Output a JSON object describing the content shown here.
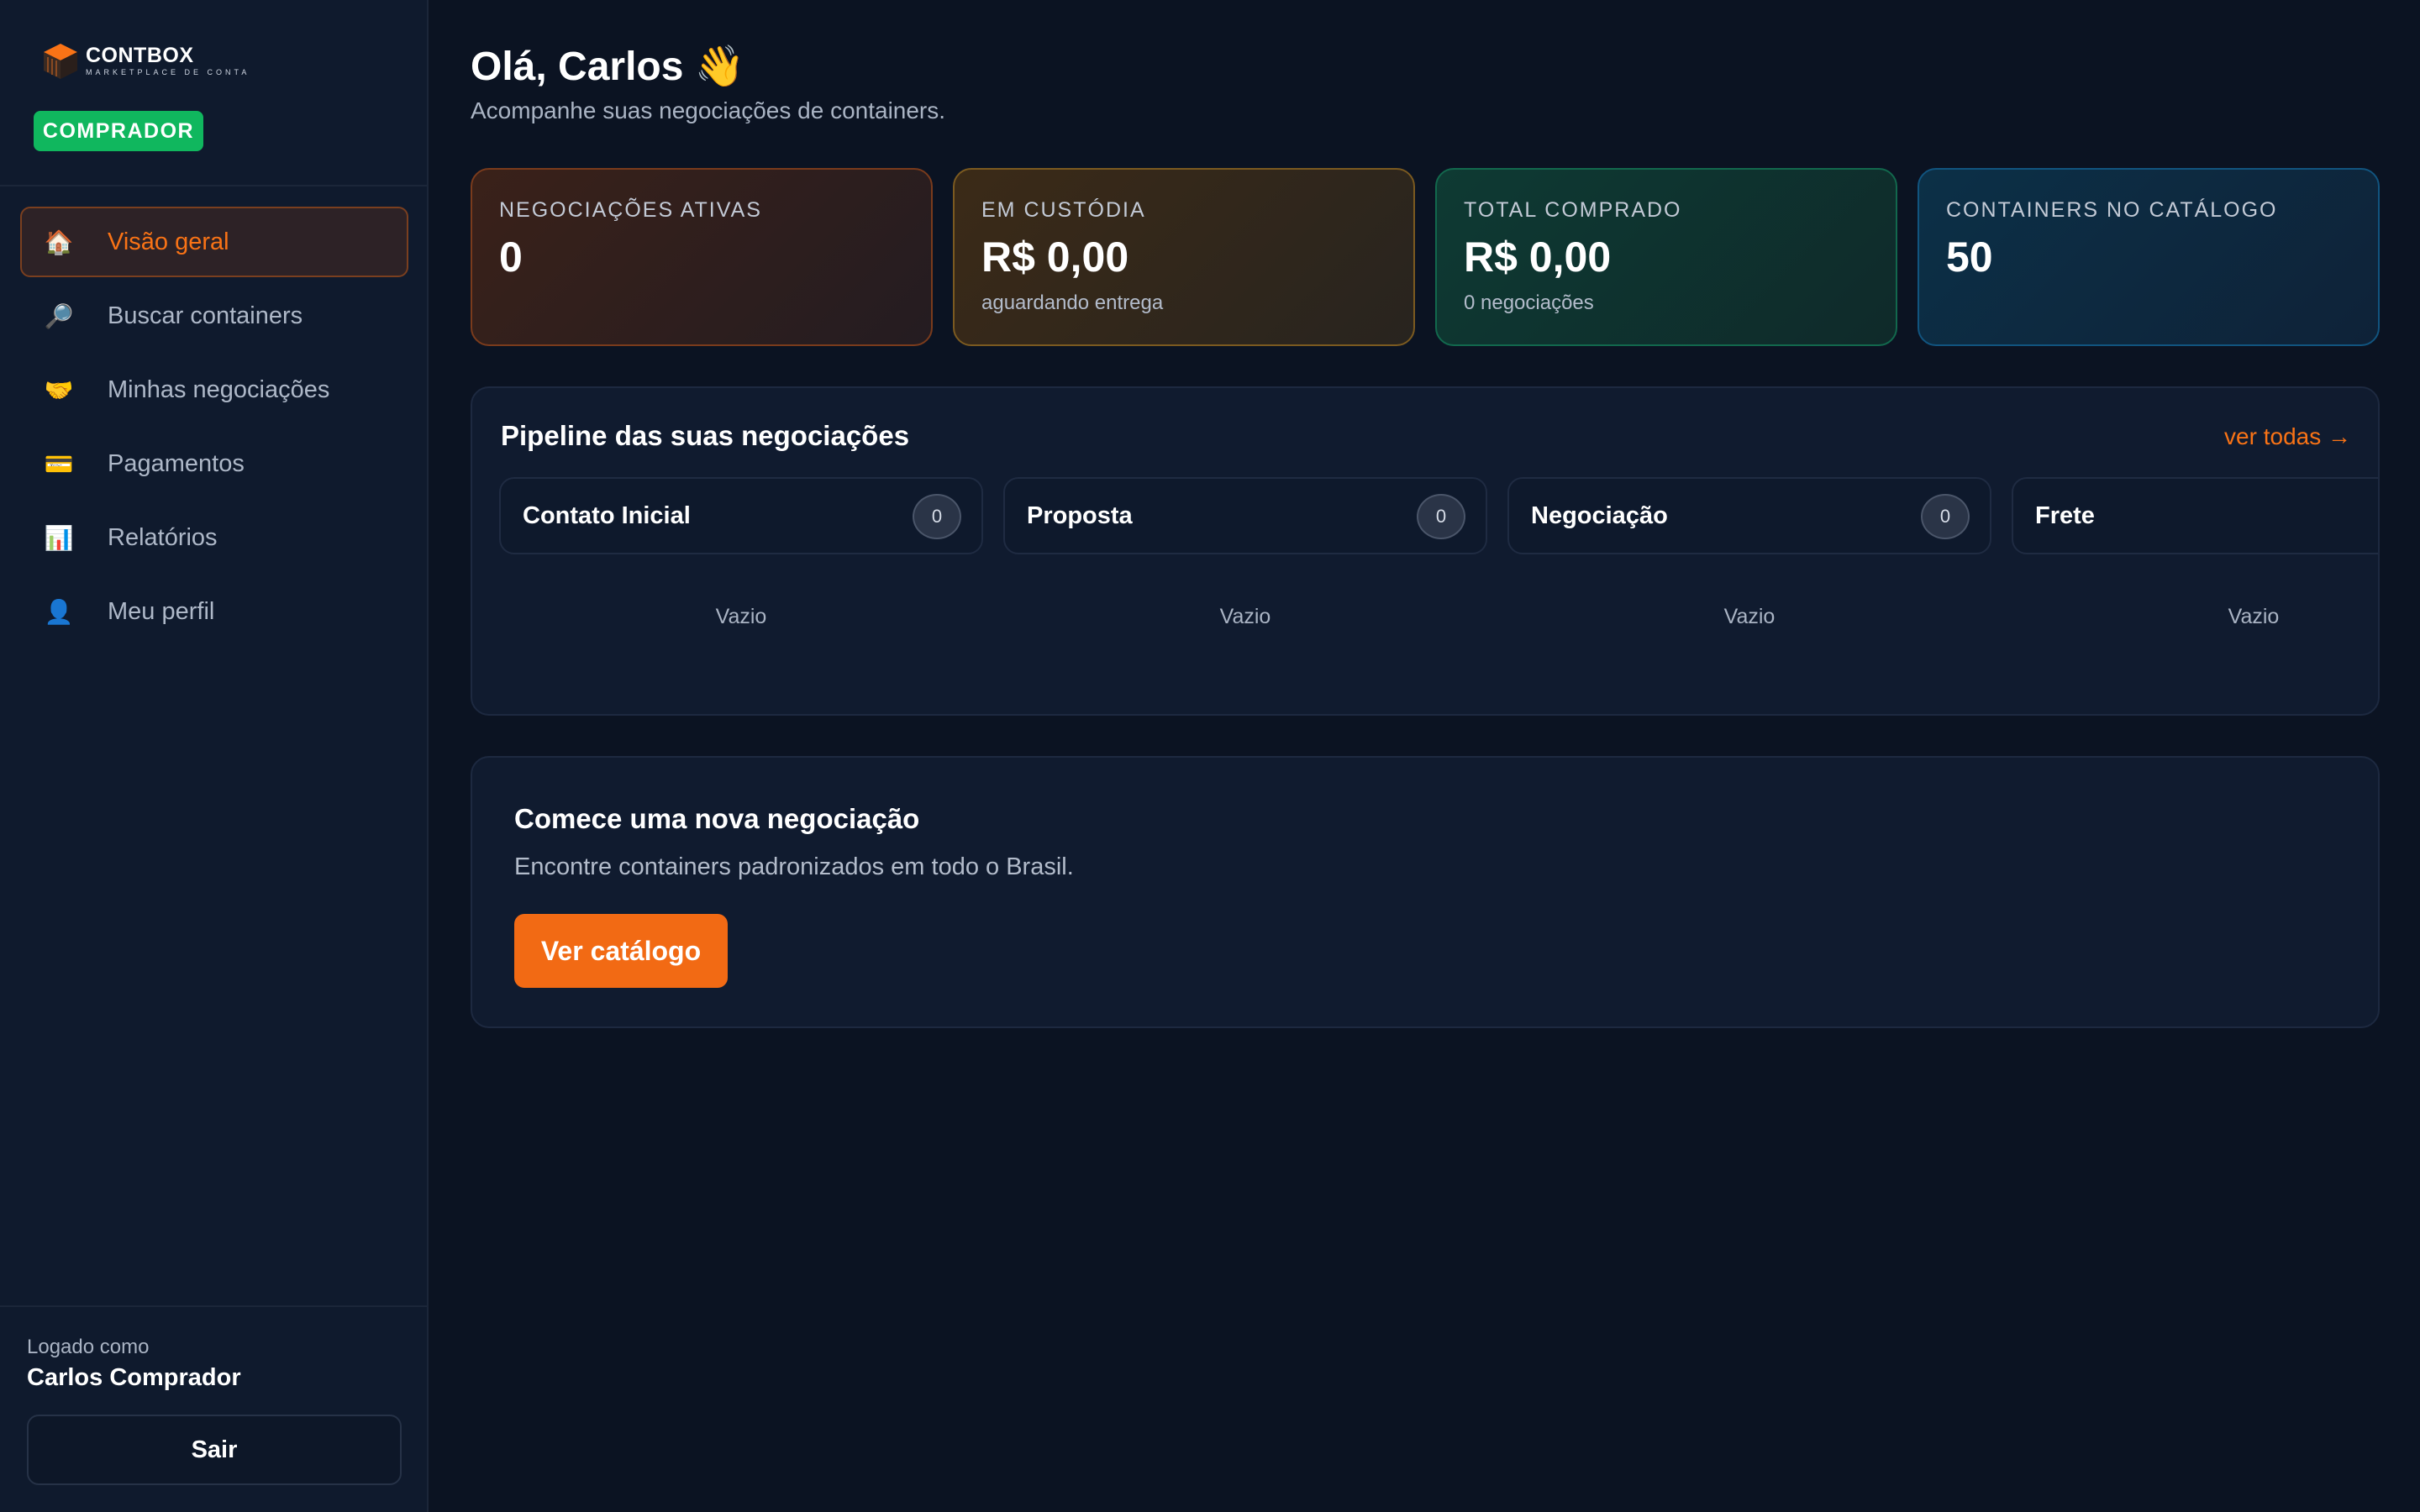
{
  "brand": {
    "name": "CONTBOX",
    "tagline": "MARKETPLACE DE CONTAINERS"
  },
  "role_badge": "COMPRADOR",
  "nav": [
    {
      "label": "Visão geral",
      "icon": "house-icon",
      "glyph": "🏠",
      "active": true
    },
    {
      "label": "Buscar containers",
      "icon": "magnifier-icon",
      "glyph": "🔎",
      "active": false
    },
    {
      "label": "Minhas negociações",
      "icon": "handshake-icon",
      "glyph": "🤝",
      "active": false
    },
    {
      "label": "Pagamentos",
      "icon": "credit-card-icon",
      "glyph": "💳",
      "active": false
    },
    {
      "label": "Relatórios",
      "icon": "bar-chart-icon",
      "glyph": "📊",
      "active": false
    },
    {
      "label": "Meu perfil",
      "icon": "user-icon",
      "glyph": "👤",
      "active": false
    }
  ],
  "user": {
    "logged_as_label": "Logado como",
    "name": "Carlos Comprador",
    "logout_label": "Sair"
  },
  "header": {
    "greeting": "Olá, Carlos 👋",
    "subtitle": "Acompanhe suas negociações de containers."
  },
  "stats": [
    {
      "label": "NEGOCIAÇÕES ATIVAS",
      "value": "0",
      "note": ""
    },
    {
      "label": "EM CUSTÓDIA",
      "value": "R$ 0,00",
      "note": "aguardando entrega"
    },
    {
      "label": "TOTAL COMPRADO",
      "value": "R$ 0,00",
      "note": "0 negociações"
    },
    {
      "label": "CONTAINERS NO CATÁLOGO",
      "value": "50",
      "note": ""
    }
  ],
  "pipeline": {
    "title": "Pipeline das suas negociações",
    "link": "ver todas →",
    "stages": [
      {
        "name": "Contato Inicial",
        "count": "0",
        "empty": "Vazio"
      },
      {
        "name": "Proposta",
        "count": "0",
        "empty": "Vazio"
      },
      {
        "name": "Negociação",
        "count": "0",
        "empty": "Vazio"
      },
      {
        "name": "Frete",
        "count": "",
        "empty": "Vazio"
      }
    ]
  },
  "cta": {
    "title": "Comece uma nova negociação",
    "text": "Encontre containers padronizados em todo o Brasil.",
    "button": "Ver catálogo"
  },
  "colors": {
    "accent": "#f97316",
    "success": "#10b75e",
    "background": "#0b1322"
  }
}
